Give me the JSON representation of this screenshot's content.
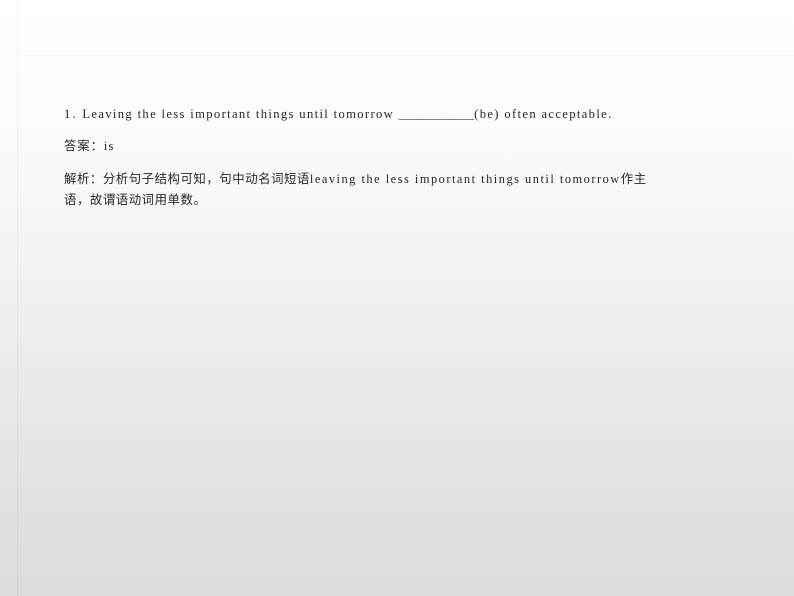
{
  "slide": {
    "background": {
      "gradient_from": "#ffffff",
      "gradient_to": "#dcdcdc",
      "rule_color": "#f0f0f0"
    },
    "text_color": "#262626"
  },
  "exercise": {
    "number": "1",
    "number_separator": ".",
    "question_before_blank": "Leaving the less important things until tomorrow",
    "blank": "____________",
    "hint": "(be)",
    "question_after_blank": "often acceptable.",
    "full_question": "1 . Leaving the less important things until tomorrow ____________(be) often acceptable."
  },
  "answer": {
    "label": "答案",
    "separator": "：",
    "value": "is",
    "full_text": "答案：is"
  },
  "explanation": {
    "label": "解析",
    "separator": "：",
    "line1_cn_a": "分析句子结构可知，句中动名词短语",
    "line1_en": "leaving the less important things until tomorrow",
    "line1_cn_b": "作主",
    "line2": "语，故谓语动词用单数。",
    "full_text": "解析：分析句子结构可知，句中动名词短语leaving the less important things until tomorrow作主语，故谓语动词用单数。"
  }
}
